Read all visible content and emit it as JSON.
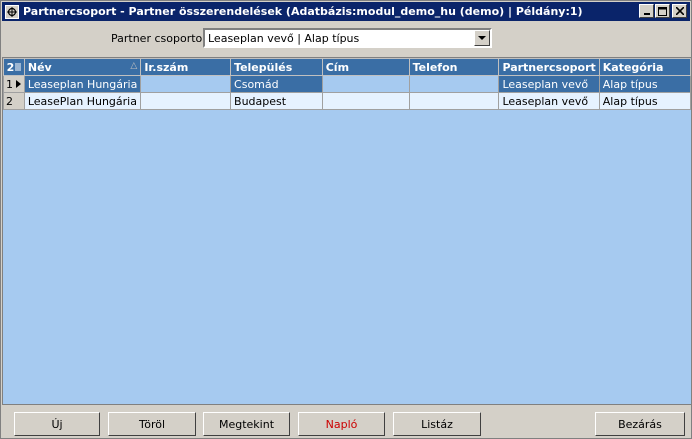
{
  "window": {
    "title": "Partnercsoport - Partner összerendelések  (Adatbázis:modul_demo_hu (demo) | Példány:1)"
  },
  "filter": {
    "label": "Partner csoportok",
    "selected": "Leaseplan vevő | Alap típus"
  },
  "grid": {
    "row_count": "2",
    "columns": [
      "Név",
      "Ir.szám",
      "Település",
      "Cím",
      "Telefon",
      "Partnercsoport",
      "Kategória"
    ],
    "rows": [
      {
        "num": "1",
        "cells": [
          "Leaseplan Hungária",
          "",
          "Csomád",
          "",
          "",
          "Leaseplan vevő",
          "Alap típus"
        ]
      },
      {
        "num": "2",
        "cells": [
          "LeasePlan Hungária",
          "",
          "Budapest",
          "",
          "",
          "Leaseplan vevő",
          "Alap típus"
        ]
      }
    ]
  },
  "buttons": {
    "new": "Új",
    "delete": "Töröl",
    "view": "Megtekint",
    "log": "Napló",
    "list": "Listáz",
    "close": "Bezárás"
  },
  "colors": {
    "titlebar": "#0a246a",
    "grid_background": "#a6caf0",
    "header": "#3a6ea5",
    "log_accent": "#cc0000"
  }
}
